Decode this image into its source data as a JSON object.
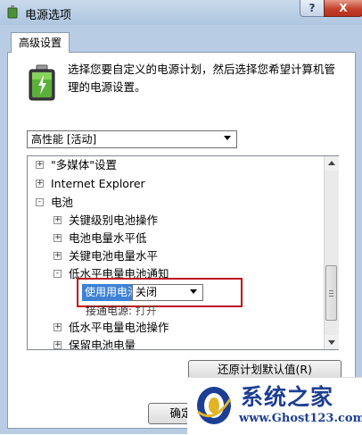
{
  "window": {
    "title": "电源选项",
    "help_label": "?",
    "close_label": "X"
  },
  "tab": {
    "label": "高级设置"
  },
  "description": "选择您要自定义的电源计划，然后选择您希望计算机管理的电源设置。",
  "plan_select": {
    "value": "高性能 [活动]"
  },
  "tree": {
    "items": [
      {
        "expander": "+",
        "label": "\"多媒体\"设置",
        "level": 0
      },
      {
        "expander": "+",
        "label": "Internet Explorer",
        "level": 0
      },
      {
        "expander": "-",
        "label": "电池",
        "level": 0
      },
      {
        "expander": "+",
        "label": "关键级别电池操作",
        "level": 1
      },
      {
        "expander": "+",
        "label": "电池电量水平低",
        "level": 1
      },
      {
        "expander": "+",
        "label": "关键电池电量水平",
        "level": 1
      },
      {
        "expander": "-",
        "label": "低水平电量电池通知",
        "level": 1
      },
      {
        "expander": "+",
        "label": "低水平电量电池操作",
        "level": 1
      },
      {
        "expander": "+",
        "label": "保留电池电量",
        "level": 1
      }
    ],
    "setting": {
      "label": "使用用电池:",
      "value": "关闭",
      "plugged_label": "接通电源:",
      "plugged_value": "打开"
    }
  },
  "buttons": {
    "restore": "还原计划默认值(R)",
    "ok": "确定"
  },
  "watermark": {
    "title": "系统之家",
    "url": "www.Ghost123.com"
  },
  "colors": {
    "selection": "#3d82d6",
    "highlight_border": "#c0131a",
    "watermark_text": "#1d3f93"
  }
}
